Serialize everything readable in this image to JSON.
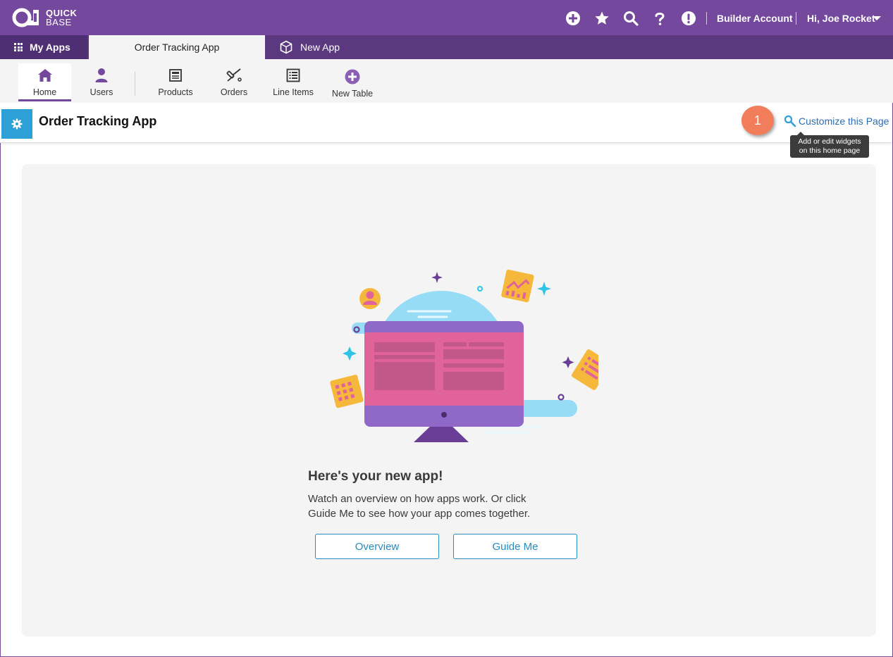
{
  "brand": {
    "line1": "QUICK",
    "line2": "BASE"
  },
  "topbar": {
    "icons": [
      "add-icon",
      "star-icon",
      "search-icon",
      "help-icon",
      "alert-icon"
    ],
    "builder_account": "Builder Account",
    "greeting": "Hi, Joe Rocket"
  },
  "app_tabs": {
    "my_apps": "My Apps",
    "current": "Order Tracking App",
    "new_app": "New App"
  },
  "table_nav": {
    "items": [
      {
        "label": "Home",
        "icon": "home-icon"
      },
      {
        "label": "Users",
        "icon": "user-icon"
      },
      {
        "label": "Products",
        "icon": "products-icon"
      },
      {
        "label": "Orders",
        "icon": "orders-icon"
      },
      {
        "label": "Line Items",
        "icon": "list-icon"
      },
      {
        "label": "New Table",
        "icon": "add-circle-icon"
      }
    ]
  },
  "page": {
    "title": "Order Tracking App",
    "customize_label": "Customize this Page",
    "step_badge": "1",
    "tooltip_line1": "Add or edit widgets",
    "tooltip_line2": "on this home page"
  },
  "main": {
    "heading": "Here's your new app!",
    "body_line1": "Watch an overview on how apps work. Or click",
    "body_line2": "Guide Me to see how your app comes together.",
    "overview_label": "Overview",
    "guide_label": "Guide Me"
  },
  "colors": {
    "header_purple": "#74489d",
    "tab_purple": "#5c3880",
    "gear_blue": "#2ea0d8",
    "link_blue": "#2b6cb8",
    "badge_orange": "#f27d5a"
  }
}
